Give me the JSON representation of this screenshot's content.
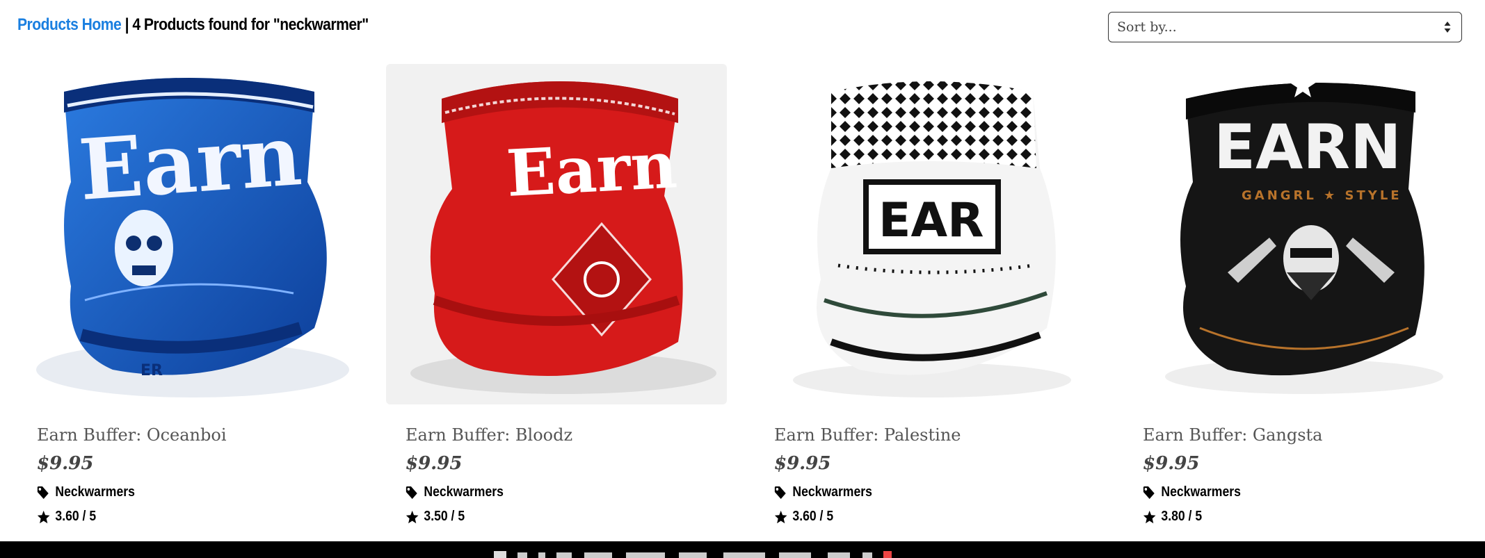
{
  "header": {
    "breadcrumb_link": "Products Home",
    "separator": "|",
    "results_text": "4 Products found for \"neckwarmer\""
  },
  "sort": {
    "selected": "Sort by..."
  },
  "products": [
    {
      "name": "Earn Buffer: Oceanboi",
      "price": "$9.95",
      "category": "Neckwarmers",
      "rating": "3.60 / 5",
      "image": "blue neck gaiter with skull",
      "accent": "#1f63c9"
    },
    {
      "name": "Earn Buffer: Bloodz",
      "price": "$9.95",
      "category": "Neckwarmers",
      "rating": "3.50 / 5",
      "image": "red neck gaiter with bandana print",
      "accent": "#d61a1a"
    },
    {
      "name": "Earn Buffer: Palestine",
      "price": "$9.95",
      "category": "Neckwarmers",
      "rating": "3.60 / 5",
      "image": "black and white keffiyeh-pattern neck gaiter",
      "accent": "#111111"
    },
    {
      "name": "Earn Buffer: Gangsta",
      "price": "$9.95",
      "category": "Neckwarmers",
      "rating": "3.80 / 5",
      "image": "black neck gaiter with skull and pistols",
      "accent": "#1a1a1a"
    }
  ],
  "icons": {
    "category": "tag-icon",
    "rating": "star-icon",
    "sort": "sort-arrows-icon"
  },
  "colors": {
    "link": "#1a7fe0",
    "footer": "#000000"
  }
}
